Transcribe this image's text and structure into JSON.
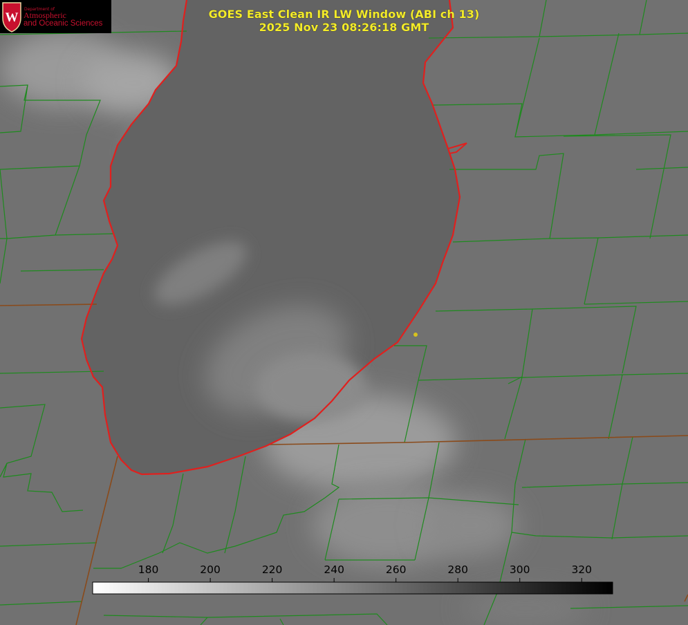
{
  "title": {
    "line1": "GOES East Clean IR LW Window (ABI ch 13)",
    "line2": "2025 Nov 23 08:26:18 GMT"
  },
  "logo": {
    "dept": "Department of",
    "line1": "Atmospheric",
    "line2": "and Oceanic Sciences",
    "emblem_letter": "W",
    "emblem_color": "#c8102e"
  },
  "colorbar": {
    "ticks": [
      "180",
      "200",
      "220",
      "240",
      "260",
      "280",
      "300",
      "320"
    ],
    "tick_values": [
      180,
      200,
      220,
      240,
      260,
      280,
      300,
      320
    ],
    "range": [
      162,
      330
    ],
    "gradient_from": "#ffffff",
    "gradient_to": "#000000"
  },
  "colors": {
    "title": "#f4ec2a",
    "county_lines": "#1e8a1e",
    "state_lines": "#8a4a1a",
    "shoreline": "#e0201e",
    "marker": "#d8c21e"
  }
}
